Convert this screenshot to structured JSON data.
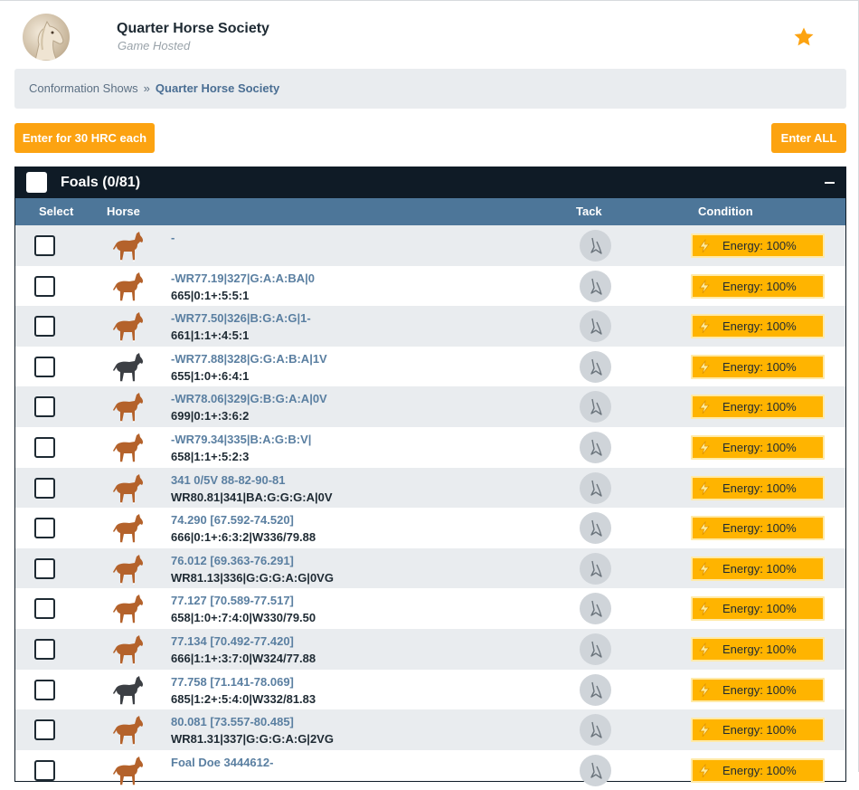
{
  "header": {
    "title": "Quarter Horse Society",
    "subtitle": "Game Hosted",
    "favorite_icon": "star-icon"
  },
  "breadcrumb": {
    "parent": "Conformation Shows",
    "separator": "»",
    "current": "Quarter Horse Society"
  },
  "actions": {
    "enter_label": "Enter for 30 HRC each",
    "enter_all_label": "Enter ALL"
  },
  "panel": {
    "title": "Foals (0/81)",
    "columns": {
      "select": "Select",
      "horse": "Horse",
      "tack": "Tack",
      "condition": "Condition"
    }
  },
  "colors": {
    "accent": "#fca311",
    "header_bg": "#0f1b26",
    "column_bg": "#4d7699",
    "energy": "#ffb400"
  },
  "rows": [
    {
      "name": "-",
      "sub": "",
      "coat": "chestnut",
      "energy": "Energy: 100%"
    },
    {
      "name": "-WR77.19|327|G:A:A:BA|0",
      "sub": "665|0:1+:5:5:1",
      "coat": "chestnut",
      "energy": "Energy: 100%"
    },
    {
      "name": "-WR77.50|326|B:G:A:G|1-",
      "sub": "661|1:1+:4:5:1",
      "coat": "chestnut",
      "energy": "Energy: 100%"
    },
    {
      "name": "-WR77.88|328|G:G:A:B:A|1V",
      "sub": "655|1:0+:6:4:1",
      "coat": "black",
      "energy": "Energy: 100%"
    },
    {
      "name": "-WR78.06|329|G:B:G:A:A|0V",
      "sub": "699|0:1+:3:6:2",
      "coat": "chestnut",
      "energy": "Energy: 100%"
    },
    {
      "name": "-WR79.34|335|B:A:G:B:V|",
      "sub": "658|1:1+:5:2:3",
      "coat": "chestnut",
      "energy": "Energy: 100%"
    },
    {
      "name": "341 0/5V 88-82-90-81",
      "sub": "WR80.81|341|BA:G:G:G:A|0V",
      "coat": "chestnut",
      "energy": "Energy: 100%"
    },
    {
      "name": "74.290 [67.592-74.520]",
      "sub": "666|0:1+:6:3:2|W336/79.88",
      "coat": "chestnut",
      "energy": "Energy: 100%"
    },
    {
      "name": "76.012 [69.363-76.291]",
      "sub": "WR81.13|336|G:G:G:A:G|0VG",
      "coat": "chestnut",
      "energy": "Energy: 100%"
    },
    {
      "name": "77.127 [70.589-77.517]",
      "sub": "658|1:0+:7:4:0|W330/79.50",
      "coat": "chestnut",
      "energy": "Energy: 100%"
    },
    {
      "name": "77.134 [70.492-77.420]",
      "sub": "666|1:1+:3:7:0|W324/77.88",
      "coat": "chestnut",
      "energy": "Energy: 100%"
    },
    {
      "name": "77.758 [71.141-78.069]",
      "sub": "685|1:2+:5:4:0|W332/81.83",
      "coat": "black",
      "energy": "Energy: 100%"
    },
    {
      "name": "80.081 [73.557-80.485]",
      "sub": "WR81.31|337|G:G:G:A:G|2VG",
      "coat": "chestnut",
      "energy": "Energy: 100%"
    },
    {
      "name": "Foal Doe 3444612-",
      "sub": "",
      "coat": "chestnut",
      "energy": "Energy: 100%"
    }
  ]
}
